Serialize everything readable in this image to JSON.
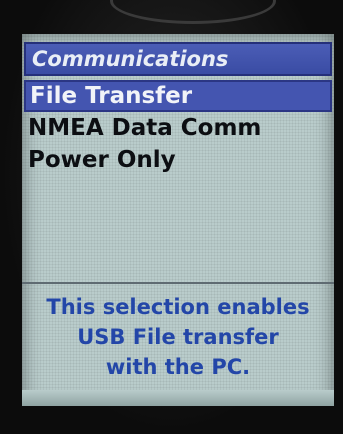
{
  "screen": {
    "title": "Communications",
    "menu": [
      {
        "label": "File Transfer",
        "selected": true
      },
      {
        "label": "NMEA Data Comm",
        "selected": false
      },
      {
        "label": "Power Only",
        "selected": false
      }
    ],
    "help_lines": [
      "This selection enables",
      "USB File transfer",
      "with the PC."
    ]
  },
  "colors": {
    "title_bar": "#3f51ac",
    "selection": "#4455b0",
    "screen_bg": "#b9cccb",
    "help_text": "#2346a8"
  }
}
